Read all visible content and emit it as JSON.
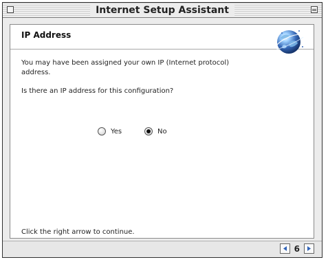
{
  "window": {
    "title": "Internet Setup Assistant"
  },
  "section": {
    "title": "IP Address"
  },
  "content": {
    "line1": "You may have been assigned your own IP (Internet protocol) address.",
    "line2": "Is there an IP address for this configuration?",
    "footer": "Click the right arrow to continue."
  },
  "radio": {
    "yes_label": "Yes",
    "no_label": "No",
    "selected": "No"
  },
  "navigation": {
    "page": "6"
  },
  "icons": {
    "close": "close-icon",
    "zoom": "zoom-icon",
    "globe": "globe-icon",
    "left_arrow": "left-arrow-icon",
    "right_arrow": "right-arrow-icon"
  },
  "colors": {
    "arrow": "#2f62b8",
    "globe_ocean": "#3566b5",
    "globe_land": "#7cb8e8"
  }
}
